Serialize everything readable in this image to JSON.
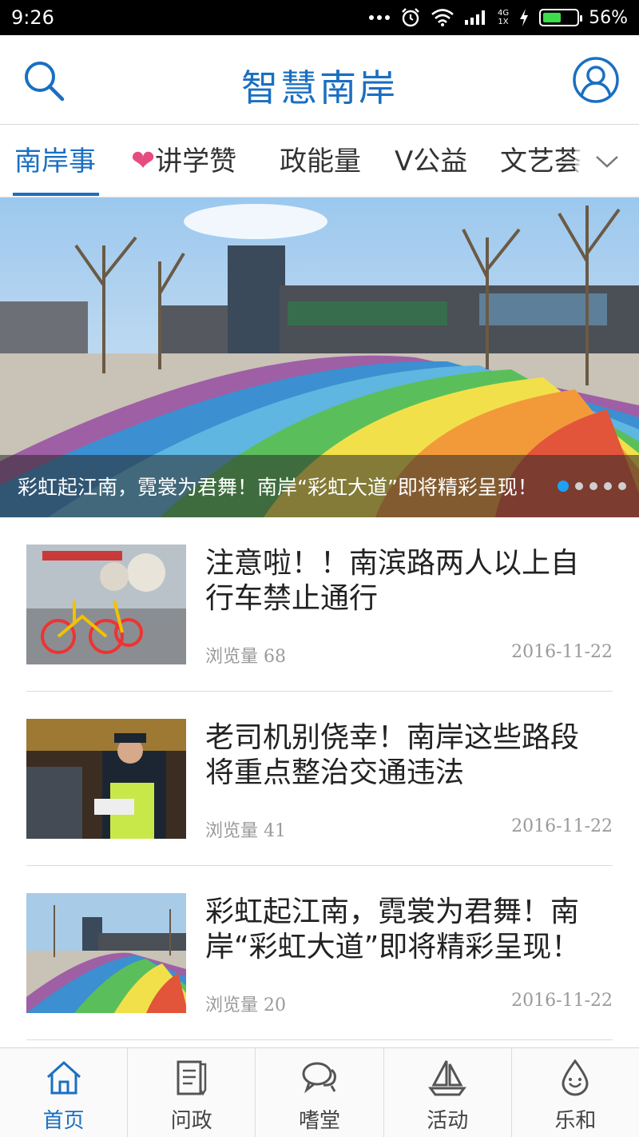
{
  "status_bar": {
    "time": "9:26",
    "network": "4G\n1X",
    "battery": "56%",
    "battery_level": 0.56
  },
  "header": {
    "title": "智慧南岸"
  },
  "tabs": [
    {
      "label": "南岸事",
      "active": true
    },
    {
      "label": "讲学赞",
      "icon": "heart-icon"
    },
    {
      "label": "政能量"
    },
    {
      "label": "V公益"
    },
    {
      "label": "文艺荟"
    }
  ],
  "banner": {
    "caption": "彩虹起江南，霓裳为君舞！南岸“彩虹大道”即将精彩呈现！",
    "slide_count": 5,
    "active_slide": 1
  },
  "news": [
    {
      "title": "注意啦！！南滨路两人以上自行车禁止通行",
      "views_label": "浏览量 68",
      "date": "2016-11-22"
    },
    {
      "title": "老司机别侥幸！南岸这些路段将重点整治交通违法",
      "views_label": "浏览量 41",
      "date": "2016-11-22"
    },
    {
      "title": "彩虹起江南，霓裳为君舞！南岸“彩虹大道”即将精彩呈现！",
      "views_label": "浏览量 20",
      "date": "2016-11-22"
    }
  ],
  "bottom_nav": [
    {
      "label": "首页",
      "icon": "home-icon",
      "active": true
    },
    {
      "label": "问政",
      "icon": "document-icon"
    },
    {
      "label": "嗜堂",
      "icon": "chat-icon"
    },
    {
      "label": "活动",
      "icon": "sailboat-icon"
    },
    {
      "label": "乐和",
      "icon": "water-drop-icon"
    }
  ],
  "colors": {
    "accent": "#1a6fc2",
    "heart": "#e64d7f",
    "dot_active": "#1da1f2"
  }
}
